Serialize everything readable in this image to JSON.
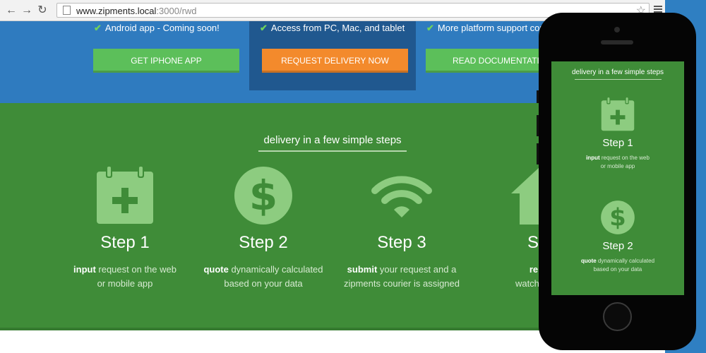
{
  "browser": {
    "url_host": "www.zipments.local",
    "url_path": ":3000/rwd"
  },
  "features": [
    {
      "text": "Android app - Coming soon!"
    },
    {
      "text": "Access from PC, Mac, and tablet"
    },
    {
      "text": "More platform support comi"
    }
  ],
  "buttons": {
    "iphone": "GET IPHONE APP",
    "request": "REQUEST DELIVERY NOW",
    "docs": "READ DOCUMENTATIO"
  },
  "steps_section": {
    "title": "delivery in a few simple steps",
    "steps": [
      {
        "title": "Step 1",
        "bold": "input",
        "rest1": " request on the web",
        "line2": "or mobile app",
        "icon": "calendar-plus-icon"
      },
      {
        "title": "Step 2",
        "bold": "quote",
        "rest1": " dynamically calculated",
        "line2": "based on your data",
        "icon": "dollar-circle-icon"
      },
      {
        "title": "Step 3",
        "bold": "submit",
        "rest1": " your request and a",
        "line2": "zipments courier is assigned",
        "icon": "wifi-icon"
      },
      {
        "title": "Ste",
        "bold": "relax",
        "rest1": "",
        "line2": "watch the m",
        "icon": "house-icon"
      }
    ]
  },
  "mobile": {
    "title": "delivery in a few simple steps",
    "steps": [
      {
        "title": "Step 1",
        "bold": "input",
        "rest1": " request on the web",
        "line2": "or mobile app"
      },
      {
        "title": "Step 2",
        "bold": "quote",
        "rest1": " dynamically calculated",
        "line2": "based on your data"
      }
    ]
  },
  "colors": {
    "blue_band": "#2f7bbf",
    "dark_blue": "#20588f",
    "green_band": "#3f8c38",
    "button_green": "#5cbf5a",
    "button_orange": "#f38a2c",
    "icon_green": "#8dcc80"
  }
}
